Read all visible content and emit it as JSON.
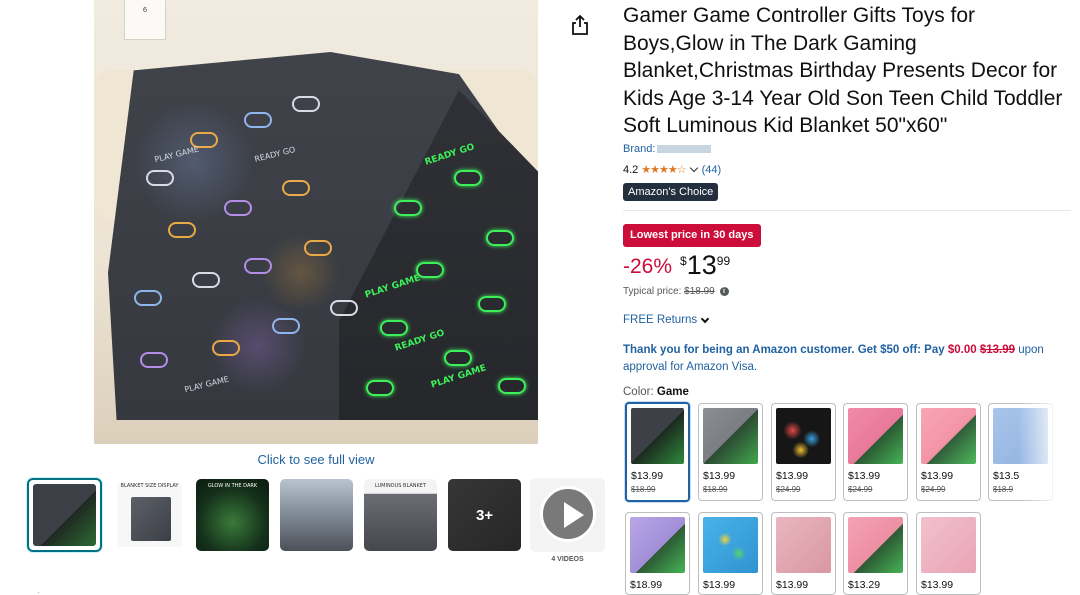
{
  "product": {
    "title": "Gamer Game Controller Gifts Toys for Boys,Glow in The Dark Gaming Blanket,Christmas Birthday Presents Decor for Kids Age 3-14 Year Old Son Teen Child Toddler Soft Luminous Kid Blanket 50\"x60\"",
    "brand_label": "Brand:",
    "rating_value": "4.2",
    "rating_stars": 4.2,
    "review_count": "(44)",
    "choice_badge": "Amazon's Choice",
    "deal_badge": "Lowest price in 30 days",
    "discount": "-26%",
    "price_symbol": "$",
    "price_whole": "13",
    "price_fraction": "99",
    "typical_label": "Typical price:",
    "typical_price": "$18.99",
    "free_returns": "FREE Returns",
    "color_label": "Color:",
    "color_value": "Game"
  },
  "visa_offer": {
    "text1": "Thank you for being an Amazon customer. Get $50 off: Pay ",
    "pay_price": "$0.00",
    "strike_price": "$13.99",
    "text2": " upon approval for Amazon Visa."
  },
  "gallery": {
    "click_note": "Click to see full view",
    "calendar_digit": "6",
    "blanket_texts": [
      "PLAY GAME",
      "READY GO",
      "PLAY GAME",
      "READY GO",
      "PLAY GAME",
      "PLAY GAME",
      "READY GO"
    ],
    "thumbnails": [
      {
        "caption": ""
      },
      {
        "caption": "BLANKET SIZE DISPLAY"
      },
      {
        "caption": "GLOW IN THE DARK"
      },
      {
        "caption": ""
      },
      {
        "caption": "LUMINOUS BLANKET"
      },
      {
        "caption": "",
        "more_label": "3+"
      }
    ],
    "video_label": "4 VIDEOS"
  },
  "swatches": [
    {
      "price": "$13.99",
      "was": "$18.99"
    },
    {
      "price": "$13.99",
      "was": "$18.99"
    },
    {
      "price": "$13.99",
      "was": "$24.99"
    },
    {
      "price": "$13.99",
      "was": "$24.99"
    },
    {
      "price": "$13.99",
      "was": "$24.99"
    },
    {
      "price": "$13.5",
      "was": "$18.9"
    },
    {
      "price": "$18.99",
      "was": ""
    },
    {
      "price": "$13.99",
      "was": ""
    },
    {
      "price": "$13.99",
      "was": ""
    },
    {
      "price": "$13.29",
      "was": ""
    },
    {
      "price": "$13.99",
      "was": ""
    }
  ],
  "colors": {
    "link": "#2162a1",
    "deal_red": "#cc0c39",
    "star": "#de7921",
    "badge_dark": "#232f3e",
    "glow_green": "#3df05a"
  },
  "icons": {
    "share": "share-icon",
    "chevron": "chevron-down-icon",
    "info": "info-icon",
    "play": "play-icon"
  }
}
